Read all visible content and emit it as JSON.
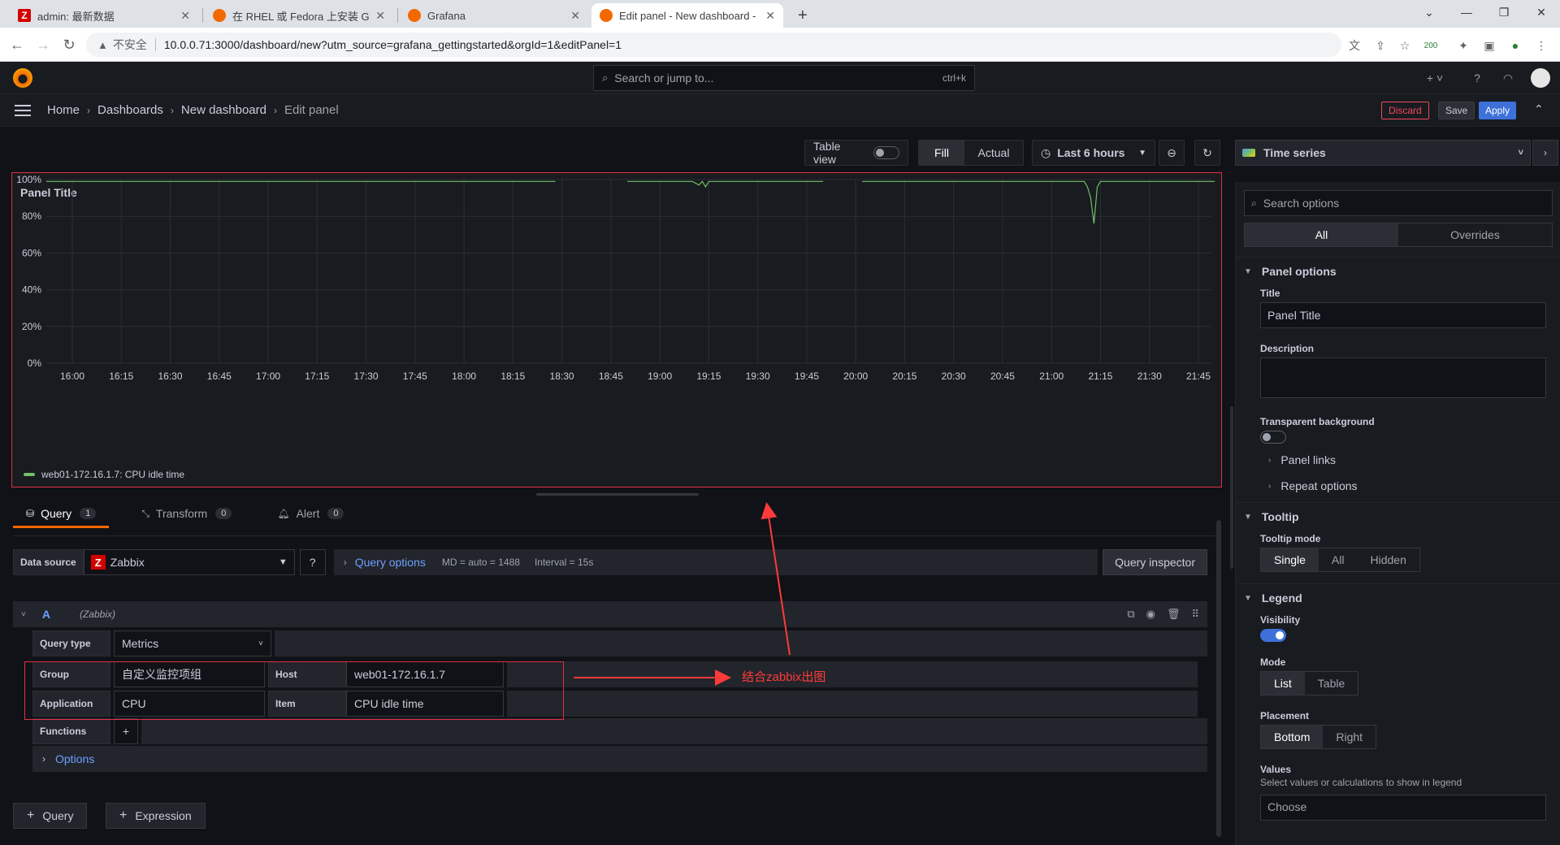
{
  "browser": {
    "tabs": [
      {
        "title": "admin: 最新数据",
        "icon": "zabbix-z"
      },
      {
        "title": "在 RHEL 或 Fedora 上安装 Grafa",
        "icon": "grafana"
      },
      {
        "title": "Grafana",
        "icon": "grafana"
      },
      {
        "title": "Edit panel - New dashboard - G",
        "icon": "grafana"
      }
    ],
    "new_tab": "+",
    "insecure_label": "不安全",
    "url": "10.0.0.71:3000/dashboard/new?utm_source=grafana_gettingstarted&orgId=1&editPanel=1",
    "ext_badge": "200"
  },
  "grafana": {
    "search_placeholder": "Search or jump to...",
    "search_shortcut": "ctrl+k",
    "breadcrumbs": [
      "Home",
      "Dashboards",
      "New dashboard",
      "Edit panel"
    ],
    "actions": {
      "discard": "Discard",
      "save": "Save",
      "apply": "Apply"
    }
  },
  "toolbar": {
    "table_view": "Table view",
    "fill": "Fill",
    "actual": "Actual",
    "time_range": "Last 6 hours"
  },
  "panel": {
    "title": "Panel Title",
    "legend": "web01-172.16.1.7: CPU idle time"
  },
  "chart_data": {
    "type": "line",
    "title": "Panel Title",
    "x_ticks": [
      "16:00",
      "16:15",
      "16:30",
      "16:45",
      "17:00",
      "17:15",
      "17:30",
      "17:45",
      "18:00",
      "18:15",
      "18:30",
      "18:45",
      "19:00",
      "19:15",
      "19:30",
      "19:45",
      "20:00",
      "20:15",
      "20:30",
      "20:45",
      "21:00",
      "21:15",
      "21:30",
      "21:45"
    ],
    "y_ticks": [
      "0%",
      "20%",
      "40%",
      "60%",
      "80%",
      "100%"
    ],
    "ylim": [
      0,
      100
    ],
    "series": [
      {
        "name": "web01-172.16.1.7: CPU idle time",
        "color": "#73bf69",
        "x": [
          "15:52",
          "16:10",
          "16:30",
          "16:50",
          "17:10",
          "17:30",
          "17:50",
          "18:10",
          "18:28",
          "18:30",
          "18:50",
          "19:10",
          "19:12",
          "19:13",
          "19:14",
          "19:15",
          "19:16",
          "19:17",
          "19:30",
          "19:50",
          "20:00",
          "20:02",
          "20:10",
          "20:30",
          "20:50",
          "21:05",
          "21:10",
          "21:11",
          "21:12",
          "21:13",
          "21:14",
          "21:15",
          "21:30",
          "21:50"
        ],
        "y": [
          99,
          99,
          99,
          99,
          99,
          99,
          99,
          99,
          99,
          null,
          99,
          99,
          97,
          99,
          96,
          99,
          99,
          99,
          99,
          99,
          null,
          99,
          99,
          99,
          99,
          99,
          99,
          96,
          90,
          76,
          96,
          99,
          99,
          99
        ]
      }
    ]
  },
  "query": {
    "tabs": [
      {
        "label": "Query",
        "count": "1"
      },
      {
        "label": "Transform",
        "count": "0"
      },
      {
        "label": "Alert",
        "count": "0"
      }
    ],
    "datasource_label": "Data source",
    "datasource": "Zabbix",
    "query_options": "Query options",
    "md": "MD = auto = 1488",
    "interval": "Interval = 15s",
    "inspector": "Query inspector",
    "ref_id": "A",
    "ds_tag": "(Zabbix)",
    "fields": {
      "query_type_label": "Query type",
      "query_type": "Metrics",
      "group_label": "Group",
      "group": "自定义监控项组",
      "host_label": "Host",
      "host": "web01-172.16.1.7",
      "application_label": "Application",
      "application": "CPU",
      "item_label": "Item",
      "item": "CPU idle time",
      "functions_label": "Functions"
    },
    "options_label": "Options",
    "add_query": "Query",
    "add_expression": "Expression",
    "annotation": "结合zabbix出图"
  },
  "options_pane": {
    "viz": "Time series",
    "search_placeholder": "Search options",
    "tab_all": "All",
    "tab_overrides": "Overrides",
    "panel_options": "Panel options",
    "title_label": "Title",
    "title_value": "Panel Title",
    "description_label": "Description",
    "transparent_label": "Transparent background",
    "panel_links": "Panel links",
    "repeat_options": "Repeat options",
    "tooltip": "Tooltip",
    "tooltip_mode_label": "Tooltip mode",
    "tooltip_modes": [
      "Single",
      "All",
      "Hidden"
    ],
    "legend": "Legend",
    "visibility_label": "Visibility",
    "mode_label": "Mode",
    "modes": [
      "List",
      "Table"
    ],
    "placement_label": "Placement",
    "placements": [
      "Bottom",
      "Right"
    ],
    "values_label": "Values",
    "values_desc": "Select values or calculations to show in legend",
    "choose": "Choose"
  }
}
